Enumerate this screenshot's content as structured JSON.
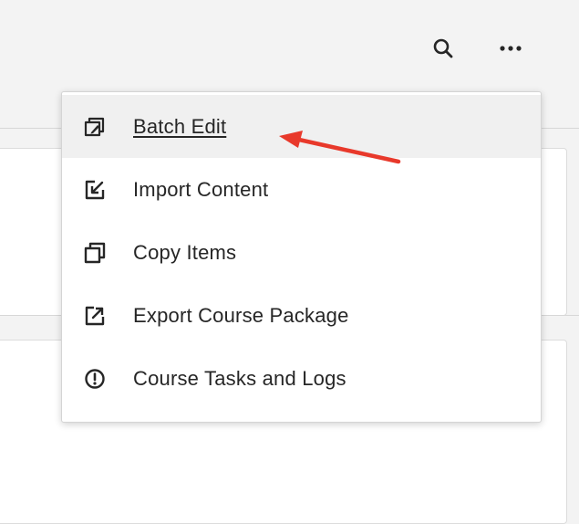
{
  "toolbar": {
    "search_icon": "search-icon",
    "more_icon": "more-options-icon"
  },
  "menu": {
    "items": [
      {
        "label": "Batch Edit",
        "icon": "batch-edit-icon",
        "active": true
      },
      {
        "label": "Import Content",
        "icon": "import-icon",
        "active": false
      },
      {
        "label": "Copy Items",
        "icon": "copy-icon",
        "active": false
      },
      {
        "label": "Export Course Package",
        "icon": "export-icon",
        "active": false
      },
      {
        "label": "Course Tasks and Logs",
        "icon": "alert-circle-icon",
        "active": false
      }
    ]
  },
  "annotation": {
    "arrow_color": "#e8392b",
    "points_to": "Batch Edit"
  },
  "colors": {
    "background": "#f3f3f3",
    "menu_background": "#ffffff",
    "active_item": "#f0f0f0",
    "text": "#262626"
  }
}
